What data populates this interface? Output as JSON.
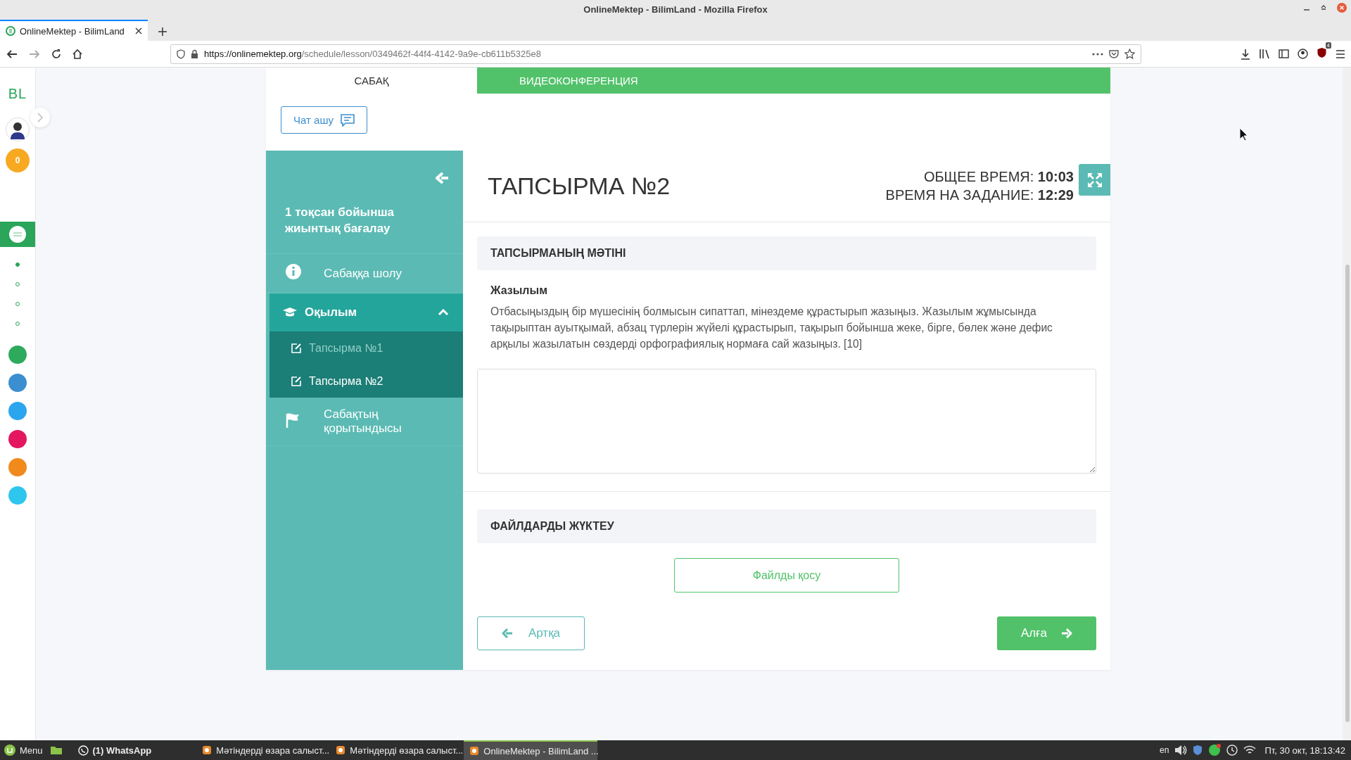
{
  "window": {
    "title": "OnlineMektep - BilimLand - Mozilla Firefox"
  },
  "browser": {
    "tab": {
      "title": "OnlineMektep - BilimLand",
      "selected": true
    },
    "url": {
      "host": "https://onlinemektep.org",
      "path": "/schedule/lesson/0349462f-44f4-4142-9a9e-cb611b5325e8"
    },
    "addon_badge": "4"
  },
  "app_rail": {
    "logo": "BL",
    "badge": "0",
    "apps": [
      {
        "selected": true
      }
    ],
    "dots": [
      {
        "selected": true
      },
      {
        "selected": false
      },
      {
        "selected": false
      },
      {
        "selected": false
      }
    ],
    "links": [
      {
        "color": "#2eaa5c"
      },
      {
        "color": "#3b8fd0"
      },
      {
        "color": "#2aa5ee"
      },
      {
        "color": "#e3165f"
      },
      {
        "color": "#f08a1c"
      },
      {
        "color": "#2fc6ee"
      }
    ]
  },
  "lesson_tabs": [
    {
      "label": "САБАҚ",
      "selected": true
    },
    {
      "label": "ВИДЕОКОНФЕРЕНЦИЯ",
      "selected": false
    }
  ],
  "chat_button": "Чат ашу",
  "lesson_nav": {
    "title": "1 тоқсан бойынша жиынтық бағалау",
    "items": [
      {
        "kind": "info",
        "label": "Сабаққа шолу"
      },
      {
        "kind": "group",
        "label": "Оқылым",
        "expanded": true,
        "children": [
          {
            "label": "Тапсырма №1",
            "selected": false
          },
          {
            "label": "Тапсырма №2",
            "selected": true
          }
        ]
      },
      {
        "kind": "flag",
        "label": "Сабақтың қорытындысы"
      }
    ]
  },
  "task": {
    "title": "ТАПСЫРМА №2",
    "timers": [
      "ОБЩЕЕ ВРЕМЯ: **10:03**",
      "ВРЕМЯ НА ЗАДАНИЕ: **12:29**"
    ],
    "text_heading": "ТАПСЫРМАНЫҢ МӘТІНІ",
    "subheading": "Жазылым",
    "body": "Отбасыңыздың бір мүшесінің болмысын сипаттап, мінездеме құрастырып жазыңыз. Жазылым жұмысында тақырыптан ауытқымай, абзац түрлерін жүйелі құрастырып, тақырып бойынша жеке, бірге, бөлек және дефис арқылы жазылатын сөздерді орфографиялық нормаға сай жазыңыз. [10]",
    "upload_heading": "ФАЙЛДАРДЫ ЖҮКТЕУ",
    "upload_button": "Файлды қосу",
    "back_button": "Артқа",
    "next_button": "Алға"
  },
  "taskbar": {
    "menu": "Menu",
    "windows": [
      {
        "kind": "whatsapp",
        "label": "(1) WhatsApp",
        "selected": false
      },
      {
        "kind": "firefox",
        "label": "Мәтіндерді өзара салыст...",
        "selected": false
      },
      {
        "kind": "firefox",
        "label": "Мәтіндерді өзара салыст...",
        "selected": false
      },
      {
        "kind": "firefox",
        "label": "OnlineMektep - BilimLand ...",
        "selected": true
      }
    ],
    "keyboard": "en",
    "clock": "Пт, 30 окт, 18:13:42"
  }
}
